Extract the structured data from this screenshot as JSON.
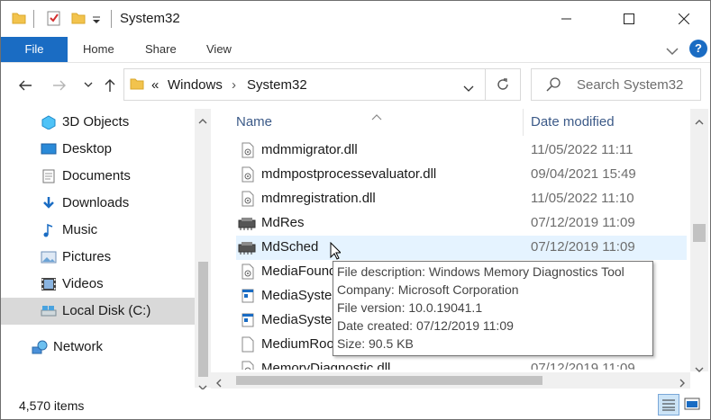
{
  "window": {
    "title": "System32"
  },
  "ribbon": {
    "tabs": [
      "File",
      "Home",
      "Share",
      "View"
    ]
  },
  "address": {
    "overflow": "«",
    "crumbs": [
      "Windows",
      "System32"
    ],
    "separator": "›"
  },
  "search": {
    "placeholder": "Search System32"
  },
  "nav": {
    "items": [
      {
        "label": "3D Objects",
        "icon": "3d-objects-icon"
      },
      {
        "label": "Desktop",
        "icon": "desktop-icon"
      },
      {
        "label": "Documents",
        "icon": "documents-icon"
      },
      {
        "label": "Downloads",
        "icon": "downloads-icon"
      },
      {
        "label": "Music",
        "icon": "music-icon"
      },
      {
        "label": "Pictures",
        "icon": "pictures-icon"
      },
      {
        "label": "Videos",
        "icon": "videos-icon"
      },
      {
        "label": "Local Disk (C:)",
        "icon": "drive-icon",
        "selected": true
      },
      {
        "label": "Network",
        "icon": "network-icon"
      }
    ]
  },
  "columns": {
    "name": "Name",
    "date": "Date modified"
  },
  "files": [
    {
      "name": "mdmmigrator.dll",
      "date": "11/05/2022 11:11",
      "icon": "dll-file-icon"
    },
    {
      "name": "mdmpostprocessevaluator.dll",
      "date": "09/04/2021 15:49",
      "icon": "dll-file-icon"
    },
    {
      "name": "mdmregistration.dll",
      "date": "11/05/2022 11:10",
      "icon": "dll-file-icon"
    },
    {
      "name": "MdRes",
      "date": "07/12/2019 11:09",
      "icon": "chip-icon"
    },
    {
      "name": "MdSched",
      "date": "07/12/2019 11:09",
      "icon": "chip-icon"
    },
    {
      "name": "MediaFoundation.DefaultPerceptionProvider.dll",
      "date": "",
      "icon": "dll-file-icon"
    },
    {
      "name": "MediaSystemUI.exe",
      "date": "",
      "icon": "app-icon"
    },
    {
      "name": "MediaSystemUIProvider.exe",
      "date": "",
      "icon": "app-icon"
    },
    {
      "name": "MediumRoot.dat",
      "date": "",
      "icon": "blank-file-icon"
    },
    {
      "name": "MemoryDiagnostic.dll",
      "date": "07/12/2019 11:09",
      "icon": "dll-file-icon"
    }
  ],
  "tooltip": {
    "lines": [
      "File description: Windows Memory Diagnostics Tool",
      "Company: Microsoft Corporation",
      "File version: 10.0.19041.1",
      "Date created: 07/12/2019 11:09",
      "Size: 90.5 KB"
    ]
  },
  "status": {
    "count": "4,570 items"
  },
  "colors": {
    "accent": "#1a6cc3",
    "hover_row": "#e5f3ff",
    "selected_nav": "#d9d9d9",
    "header_text": "#3c5a88"
  }
}
